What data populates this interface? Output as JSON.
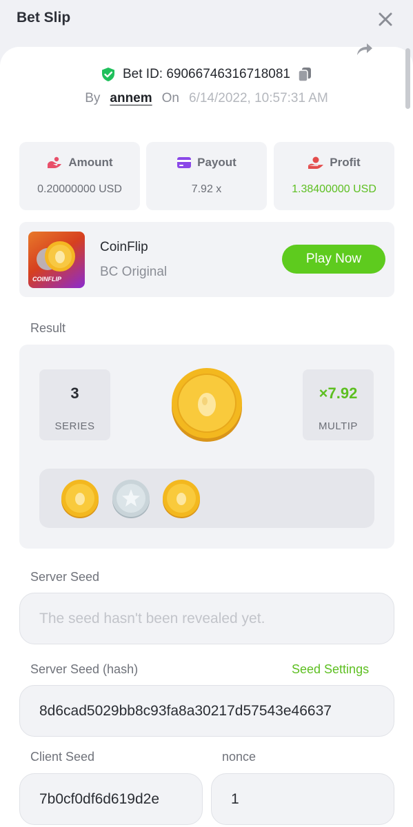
{
  "header": {
    "title": "Bet Slip"
  },
  "bet": {
    "id_label": "Bet ID: 69066746316718081",
    "by_label": "By",
    "username": "annem",
    "on_label": "On",
    "datetime": "6/14/2022, 10:57:31 AM"
  },
  "stats": {
    "amount": {
      "label": "Amount",
      "value": "0.20000000 USD"
    },
    "payout": {
      "label": "Payout",
      "value": "7.92 x"
    },
    "profit": {
      "label": "Profit",
      "value": "1.38400000 USD"
    }
  },
  "game": {
    "thumb_label": "COINFLIP",
    "name": "CoinFlip",
    "provider": "BC Original",
    "play_label": "Play Now"
  },
  "result": {
    "label": "Result",
    "series_value": "3",
    "series_label": "SERIES",
    "multiplier_value": "×7.92",
    "multiplier_label": "MULTIP",
    "coins": [
      "gold",
      "silver",
      "gold"
    ]
  },
  "server_seed": {
    "label": "Server Seed",
    "placeholder": "The seed hasn't been revealed yet."
  },
  "server_seed_hash": {
    "label": "Server Seed (hash)",
    "settings_link": "Seed Settings",
    "value": "8d6cad5029bb8c93fa8a30217d57543e46637"
  },
  "client_seed": {
    "label": "Client Seed",
    "value": "7b0cf0df6d619d2e"
  },
  "nonce": {
    "label": "nonce",
    "value": "1"
  },
  "colors": {
    "accent_green": "#5ecb1e",
    "profit_green": "#5dbf21",
    "shield_green": "#20c05c",
    "card_bg": "#f2f3f6"
  }
}
